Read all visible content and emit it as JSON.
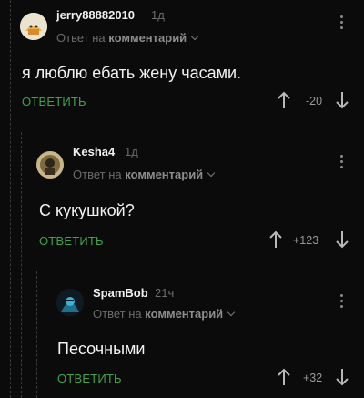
{
  "comments": [
    {
      "username": "jerry88882010",
      "time": "1д",
      "reply_prefix": "Ответ на",
      "reply_link": "комментарий",
      "text": "я люблю ебать жену часами.",
      "reply_button": "ОТВЕТИТЬ",
      "rating": "-20",
      "icons": [
        "avatar",
        "menu-dots-icon",
        "arrow-up-icon",
        "arrow-down-icon",
        "chevron-down-icon"
      ]
    },
    {
      "username": "Kesha4",
      "time": "1д",
      "reply_prefix": "Ответ на",
      "reply_link": "комментарий",
      "text": "С кукушкой?",
      "reply_button": "ОТВЕТИТЬ",
      "rating": "+123"
    },
    {
      "username": "SpamBob",
      "time": "21ч",
      "reply_prefix": "Ответ на",
      "reply_link": "комментарий",
      "text": "Песочными",
      "reply_button": "ОТВЕТИТЬ",
      "rating": "+32"
    }
  ],
  "colors": {
    "background": "#0b0b0b",
    "reply_button": "#3fa34d",
    "muted_text": "#6c6c6c"
  }
}
